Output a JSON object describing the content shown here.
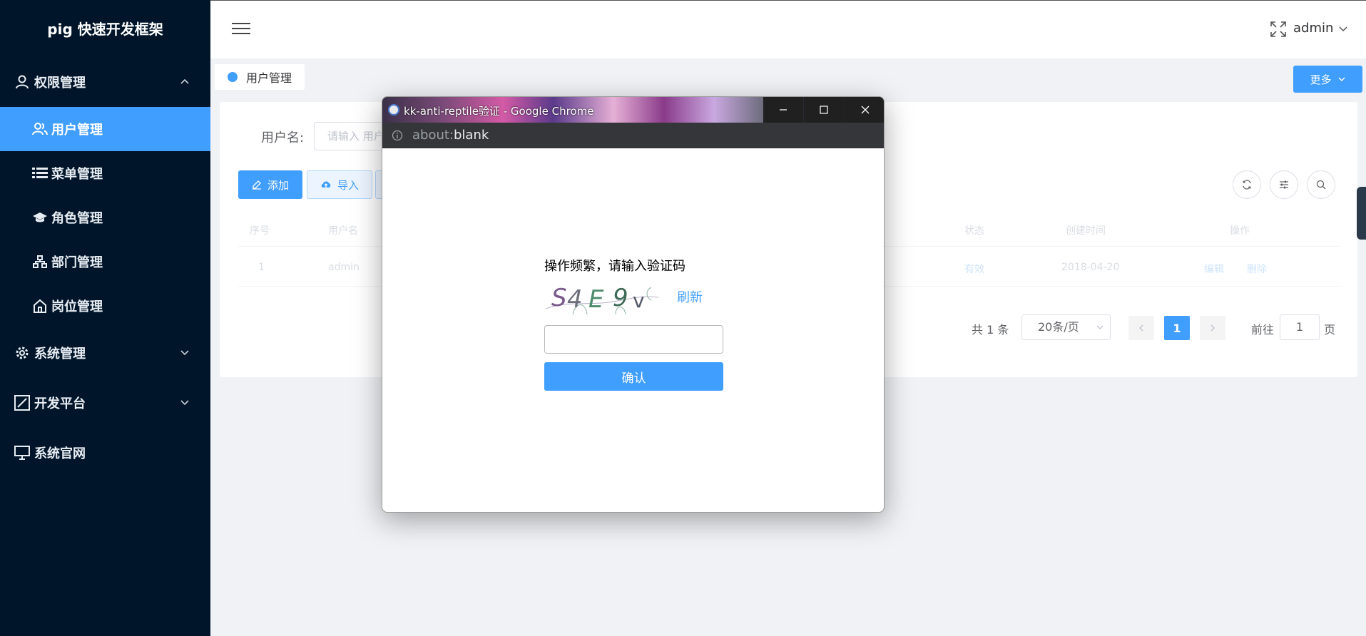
{
  "sidebar": {
    "logo": "pig 快速开发框架",
    "group_auth": "权限管理",
    "items": [
      {
        "label": "用户管理"
      },
      {
        "label": "菜单管理"
      },
      {
        "label": "角色管理"
      },
      {
        "label": "部门管理"
      },
      {
        "label": "岗位管理"
      }
    ],
    "group_system": "系统管理",
    "group_dev": "开发平台",
    "group_site": "系统官网"
  },
  "header": {
    "user": "admin"
  },
  "tags": {
    "active_tag": "用户管理",
    "more_label": "更多"
  },
  "search": {
    "username_label": "用户名:",
    "username_placeholder": "请输入 用户"
  },
  "toolbar": {
    "add_label": "添加",
    "import_label": "导入"
  },
  "table": {
    "headers": [
      "序号",
      "用户名",
      "状态",
      "创建时间",
      "操作"
    ],
    "rows": [
      {
        "index": "1",
        "username": "admin",
        "status": "有效",
        "created": "2018-04-20",
        "edit": "编辑",
        "delete": "删除"
      }
    ]
  },
  "pagination": {
    "total": "共 1 条",
    "page_size": "20条/页",
    "current_page": "1",
    "goto_label": "前往",
    "goto_value": "1",
    "page_suffix": "页"
  },
  "popup": {
    "title": "kk-anti-reptile验证 - Google Chrome",
    "url_scheme": "about:",
    "url_path": "blank",
    "prompt": "操作频繁，请输入验证码",
    "captcha_text": "S4E9v",
    "refresh_label": "刷新",
    "input_value": "",
    "confirm_label": "确认"
  },
  "colors": {
    "sidebar_bg": "#001529",
    "primary": "#409eff"
  }
}
